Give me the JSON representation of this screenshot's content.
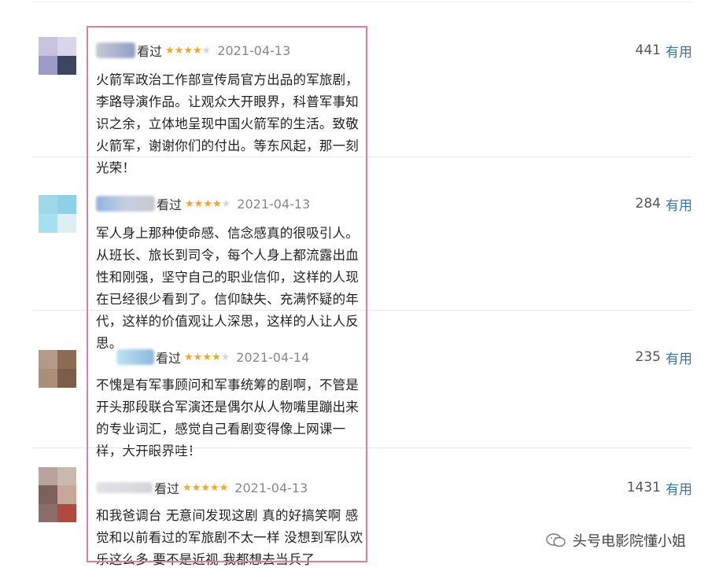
{
  "comments": [
    {
      "watched": "看过",
      "stars": "★★★★",
      "stars_off": "★",
      "date": "2021-04-13",
      "votes": "441",
      "useful": "有用",
      "text": "火箭军政治工作部宣传局官方出品的军旅剧，李路导演作品。让观众大开眼界，科普军事知识之余，立体地呈现中国火箭军的生活。致敬火箭军，谢谢你们的付出。等东风起，那一刻光荣！",
      "avatar_colors": [
        "#c8c2de",
        "#d9d5ea",
        "#9a9bc9",
        "#3e4560"
      ]
    },
    {
      "watched": "看过",
      "stars": "★★★★",
      "stars_off": "★",
      "date": "2021-04-13",
      "votes": "284",
      "useful": "有用",
      "text": "军人身上那种使命感、信念感真的很吸引人。从班长、旅长到司令，每个人身上都流露出血性和刚强，坚守自己的职业信仰，这样的人现在已经很少看到了。信仰缺失、充满怀疑的年代，这样的价值观让人深思，这样的人让人反思。",
      "avatar_colors": [
        "#9fd7ea",
        "#8cd0ea",
        "#a6dff0",
        "#dfeef4"
      ]
    },
    {
      "watched": "看过",
      "stars": "★★★★",
      "stars_off": "★",
      "date": "2021-04-14",
      "votes": "235",
      "useful": "有用",
      "text": "不愧是有军事顾问和军事统筹的剧啊，不管是开头那段联合军演还是偶尔从人物嘴里蹦出来的专业词汇，感觉自己看剧变得像上网课一样，大开眼界哇！",
      "avatar_colors": [
        "#b39a86",
        "#8c6b55",
        "#a98e78",
        "#7a5d4a"
      ]
    },
    {
      "watched": "看过",
      "stars": "★★★★★",
      "stars_off": "",
      "date": "2021-04-13",
      "votes": "1431",
      "useful": "有用",
      "text": "和我爸调台 无意间发现这剧 真的好搞笑啊 感觉和以前看过的军旅剧不太一样 没想到军队欢乐这么多 要不是近视 我都想去当兵了",
      "avatar_colors": [
        "#b8a49a",
        "#c9b8ad",
        "#7d6158",
        "#c8a79a",
        "#8c6e68",
        "#b04a3e"
      ]
    }
  ],
  "watermark": "头号电影院懂小姐"
}
